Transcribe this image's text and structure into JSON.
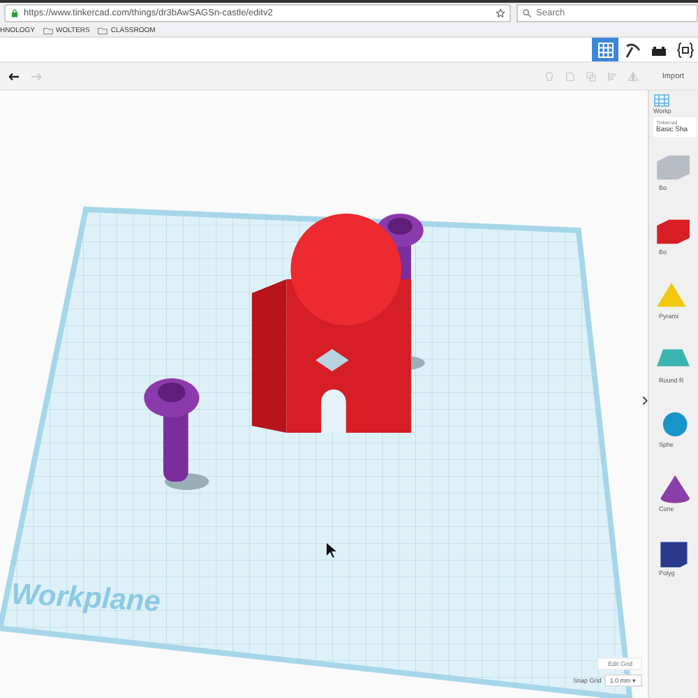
{
  "browser": {
    "url": "https://www.tinkercad.com/things/dr3bAwSAGSn-castle/editv2",
    "search": {
      "placeholder": "Search"
    },
    "bookmarks": [
      {
        "label": "HNOLOGY",
        "kind": "link"
      },
      {
        "label": "WOLTERS",
        "kind": "folder"
      },
      {
        "label": "CLASSROOM",
        "kind": "folder"
      }
    ]
  },
  "view_modes": [
    {
      "kind": "grid",
      "selected": true
    },
    {
      "kind": "pickaxe",
      "selected": false
    },
    {
      "kind": "bricks",
      "selected": false
    },
    {
      "kind": "code",
      "selected": false
    }
  ],
  "toolbar": {
    "import": "Import"
  },
  "workplane": {
    "label": "Workplane",
    "edit_grid": "Edit Grid",
    "snap_grid_label": "Snap Grid",
    "snap_grid_value": "1.0 mm ▾"
  },
  "panel": {
    "workplane": "Workp",
    "library_source": "Tinkercad",
    "library": "Basic Sha",
    "shapes": [
      {
        "kind": "hole-box",
        "label": "Bo"
      },
      {
        "kind": "box",
        "label": "Bo"
      },
      {
        "kind": "pyramid",
        "label": "Pyrami"
      },
      {
        "kind": "roof",
        "label": "Round R"
      },
      {
        "kind": "sphere",
        "label": "Sphe"
      },
      {
        "kind": "cone",
        "label": "Cone"
      },
      {
        "kind": "polygon",
        "label": "Polyg"
      }
    ]
  }
}
